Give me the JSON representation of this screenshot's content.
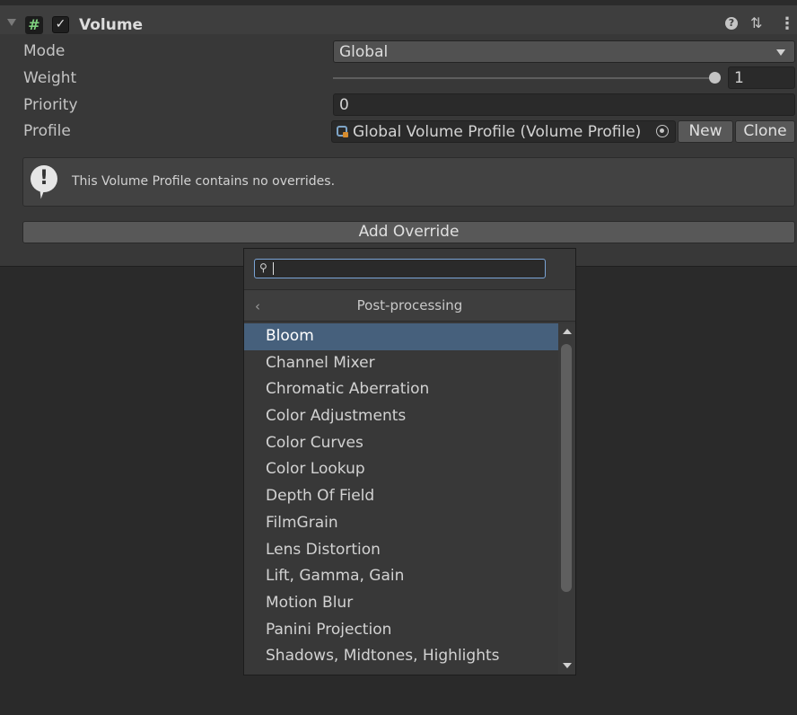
{
  "component": {
    "title": "Volume",
    "enabled_glyph": "✓",
    "script_icon_glyph": "#",
    "help_glyph": "?",
    "presets_glyph": "⇅",
    "menu_glyph": "⋮"
  },
  "fields": {
    "mode_label": "Mode",
    "mode_value": "Global",
    "weight_label": "Weight",
    "weight_value": "1",
    "weight_fraction": 1,
    "priority_label": "Priority",
    "priority_value": "0",
    "profile_label": "Profile",
    "profile_value": "Global Volume Profile (Volume Profile)",
    "new_button": "New",
    "clone_button": "Clone"
  },
  "helpbox": {
    "icon_glyph": "!",
    "text": "This Volume Profile contains no overrides."
  },
  "add_override": {
    "label": "Add Override"
  },
  "popup": {
    "search_value": "",
    "search_glyph": "⚲",
    "back_glyph": "‹",
    "title": "Post-processing",
    "selected_index": 0,
    "items": [
      "Bloom",
      "Channel Mixer",
      "Chromatic Aberration",
      "Color Adjustments",
      "Color Curves",
      "Color Lookup",
      "Depth Of Field",
      "FilmGrain",
      "Lens Distortion",
      "Lift, Gamma, Gain",
      "Motion Blur",
      "Panini Projection",
      "Shadows, Midtones, Highlights"
    ]
  },
  "colors": {
    "selection": "#46607c",
    "focus": "#7aa4d6",
    "script_icon": "#7fd07f"
  },
  "icons": [
    "foldout-arrow-icon",
    "script-icon",
    "checkbox-icon",
    "help-icon",
    "presets-icon",
    "kebab-menu-icon",
    "info-icon",
    "volume-profile-icon",
    "object-picker-icon",
    "search-icon",
    "back-icon"
  ]
}
